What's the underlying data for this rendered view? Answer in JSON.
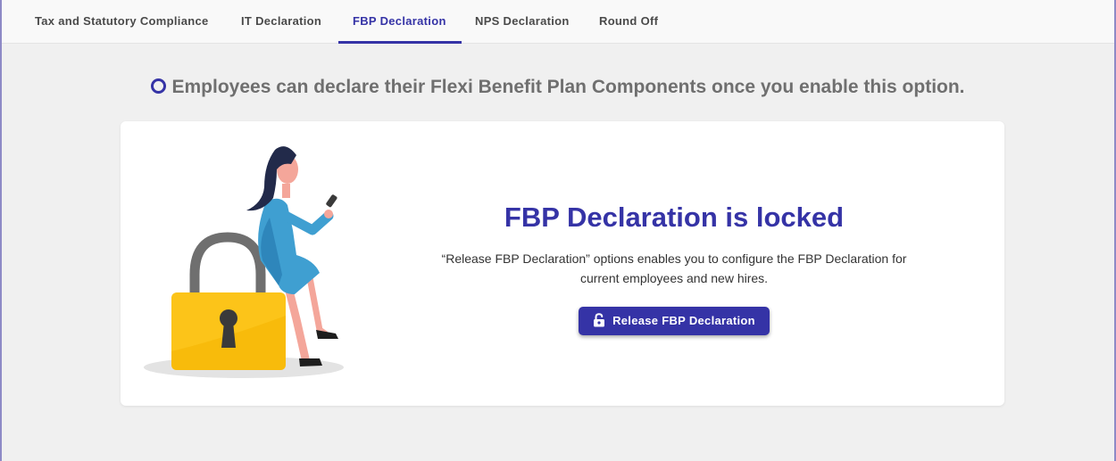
{
  "tabs": [
    {
      "label": "Tax and Statutory Compliance"
    },
    {
      "label": "IT Declaration"
    },
    {
      "label": "FBP Declaration",
      "active": true
    },
    {
      "label": "NPS Declaration"
    },
    {
      "label": "Round Off"
    }
  ],
  "info": {
    "text": "Employees can declare their Flexi Benefit Plan Components once you enable this option.",
    "icon": "ring-icon"
  },
  "card": {
    "title": "FBP Declaration is locked",
    "description_line1": "“Release FBP Declaration” options enables you to configure the FBP Declaration for",
    "description_line2": "current employees and new hires.",
    "button_label": "Release FBP Declaration",
    "button_icon": "unlock-icon",
    "illustration": "woman-on-padlock-illustration"
  },
  "colors": {
    "accent": "#3533a6",
    "page_bg": "#f0f0f0",
    "tab_bg": "#f9f9f9",
    "lock_yellow": "#fcc419"
  }
}
